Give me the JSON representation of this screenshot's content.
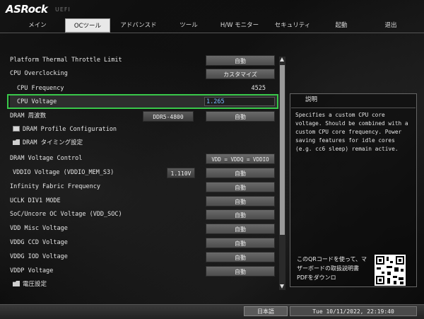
{
  "header": {
    "brand": "ASRock",
    "uefi_label": "UEFI"
  },
  "nav": {
    "tabs": [
      {
        "label": "メイン",
        "active": false
      },
      {
        "label": "OCツール",
        "active": true
      },
      {
        "label": "アドバンスド",
        "active": false
      },
      {
        "label": "ツール",
        "active": false
      },
      {
        "label": "H/W モニター",
        "active": false
      },
      {
        "label": "セキュリティ",
        "active": false
      },
      {
        "label": "起動",
        "active": false
      },
      {
        "label": "退出",
        "active": false
      }
    ]
  },
  "settings": [
    {
      "label": "Platform Thermal Throttle Limit",
      "control": "自動"
    },
    {
      "label": "CPU Overclocking",
      "control": "カスタマイズ"
    },
    {
      "label": "CPU Frequency",
      "value": "4525"
    },
    {
      "label": "CPU Voltage",
      "input": "1.265"
    },
    {
      "label": "DRAM 周波数",
      "value": "DDR5-4800",
      "control": "自動"
    },
    {
      "label": "DRAM Profile Configuration"
    },
    {
      "label": "DRAM タイミング設定"
    },
    {
      "label": "DRAM Voltage Control",
      "control": "VDD = VDDQ = VDDIO"
    },
    {
      "label": "VDDIO Voltage (VDDIO_MEM_S3)",
      "value": "1.110V",
      "control": "自動"
    },
    {
      "label": "Infinity Fabric Frequency",
      "control": "自動"
    },
    {
      "label": "UCLK DIV1 MODE",
      "control": "自動"
    },
    {
      "label": "SoC/Uncore OC Voltage (VDD_SOC)",
      "control": "自動"
    },
    {
      "label": "VDD Misc Voltage",
      "control": "自動"
    },
    {
      "label": "VDDG CCD Voltage",
      "control": "自動"
    },
    {
      "label": "VDDG IOD Voltage",
      "control": "自動"
    },
    {
      "label": "VDDP Voltage",
      "control": "自動"
    },
    {
      "label": "電圧設定"
    }
  ],
  "description": {
    "title": "説明",
    "text": "Specifies a custom CPU core voltage. Should be combined with a custom CPU core frequency. Power saving features for idle cores (e.g. cc6 sleep) remain active.",
    "qr_text": "このQRコードを使って、マザーボードの取扱説明書PDFをダウンロ"
  },
  "footer": {
    "language": "日本語",
    "datetime": "Tue 10/11/2022, 22:19:40"
  },
  "colors": {
    "selection": "#39c84a",
    "input_text": "#79b8ff"
  }
}
